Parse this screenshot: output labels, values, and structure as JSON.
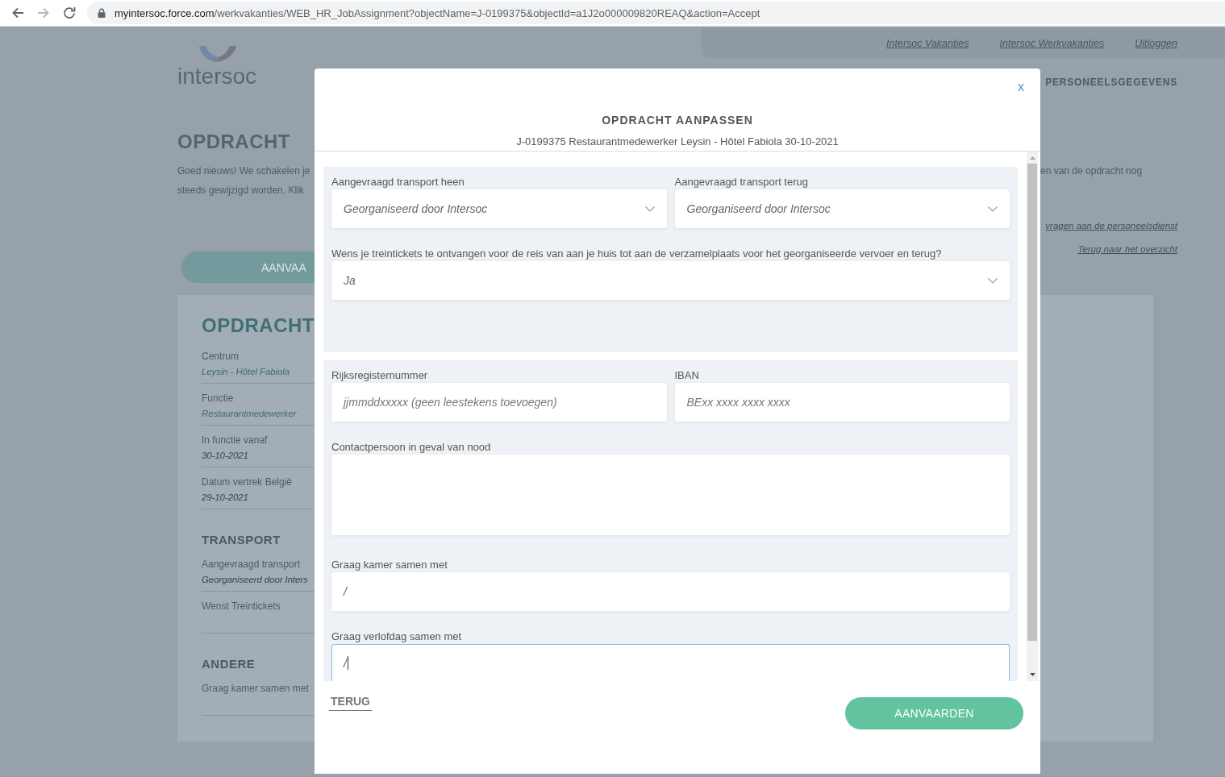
{
  "browser": {
    "nav": [
      {
        "kind": "back",
        "disabled": false
      },
      {
        "kind": "forward",
        "disabled": true
      },
      {
        "kind": "reload",
        "disabled": false
      }
    ],
    "address": {
      "host": "myintersoc.force.com",
      "path": "/werkvakanties/WEB_HR_JobAssignment?objectName=J-0199375&objectId=a1J2o000009820REAQ&action=Accept"
    }
  },
  "page": {
    "logo": {
      "wordmark": "intersoc"
    },
    "top_links": [
      "Intersoc Vakanties",
      "Intersoc Werkvakanties",
      "Uitloggen"
    ],
    "nav_item": "PERSONEELSGEGEVENS",
    "heading": "OPDRACHT",
    "intro_left": [
      "Goed nieuws! We schakelen je",
      "steeds gewijzigd worden. Klik"
    ],
    "intro_right": "en van de opdracht nog",
    "side_links": [
      "vragen aan de personeelsdienst",
      "Terug naar het overzicht"
    ],
    "accept_button": "AANVAA",
    "card": {
      "sections": [
        {
          "kind": "main",
          "title": "OPDRACHT",
          "fields": [
            {
              "label": "Centrum",
              "value": "Leysin - Hôtel Fabiola",
              "kind": "accent"
            },
            {
              "label": "Functie",
              "value": "Restaurantmedewerker",
              "kind": "accent"
            },
            {
              "label": "In functie vanaf",
              "value": "30-10-2021",
              "kind": "plain"
            },
            {
              "label": "Datum vertrek België",
              "value": "29-10-2021",
              "kind": "plain"
            }
          ]
        },
        {
          "kind": "sub",
          "title": "TRANSPORT",
          "fields": [
            {
              "label": "Aangevraagd transport",
              "value": "Georganiseerd door Inters",
              "kind": "plain"
            },
            {
              "label": "Wenst Treintickets"
            }
          ]
        },
        {
          "kind": "sub",
          "title": "ANDERE",
          "fields": [
            {
              "label": "Graag kamer samen met"
            }
          ]
        }
      ]
    }
  },
  "modal": {
    "close": "x",
    "title": "OPDRACHT AANPASSEN",
    "subtitle": "J-0199375 Restaurantmedewerker Leysin - Hôtel Fabiola 30-10-2021",
    "sections": [
      {
        "rows": [
          {
            "fields": [
              {
                "kind": "select",
                "label": "Aangevraagd transport heen",
                "value": "Georganiseerd door Intersoc",
                "focused": false
              },
              {
                "kind": "select",
                "label": "Aangevraagd transport terug",
                "value": "Georganiseerd door Intersoc",
                "focused": false
              }
            ]
          },
          {
            "fields": [
              {
                "kind": "select",
                "label": "Wens je treintickets te ontvangen voor de reis van aan je huis tot aan de verzamelplaats voor het georganiseerde vervoer en terug?",
                "value": "Ja",
                "focused": false
              }
            ]
          }
        ]
      },
      {
        "rows": [
          {
            "fields": [
              {
                "kind": "input",
                "label": "Rijksregisternummer",
                "placeholder": "jjmmddxxxxx (geen leestekens toevoegen)",
                "focused": false
              },
              {
                "kind": "input",
                "label": "IBAN",
                "placeholder": "BExx xxxx xxxx xxxx",
                "focused": false
              }
            ]
          },
          {
            "fields": [
              {
                "kind": "textarea",
                "label": "Contactpersoon in geval van nood",
                "focused": false
              }
            ]
          },
          {
            "fields": [
              {
                "kind": "input",
                "label": "Graag kamer samen met",
                "value": "/",
                "focused": false
              }
            ]
          },
          {
            "fields": [
              {
                "kind": "input",
                "label": "Graag verlofdag samen met",
                "value": "/",
                "focused": true
              }
            ]
          }
        ]
      }
    ],
    "back": "TERUG",
    "accept": "AANVAARDEN"
  }
}
